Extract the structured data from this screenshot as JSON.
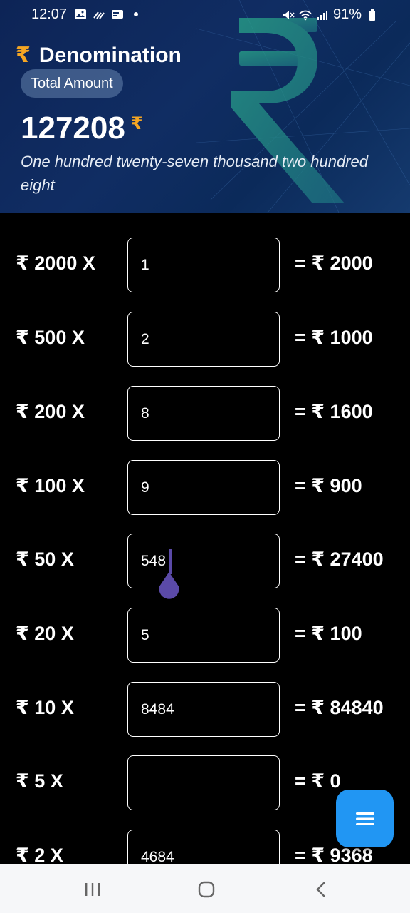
{
  "status_bar": {
    "time": "12:07",
    "battery": "91%"
  },
  "header": {
    "app_title": "Denomination",
    "total_label": "Total Amount",
    "total_value": "127208",
    "currency_symbol": "₹",
    "amount_in_words": "One hundred twenty-seven thousand two hundred eight"
  },
  "rows": [
    {
      "label": "₹ 2000 X",
      "value": "1",
      "result": "= ₹ 2000"
    },
    {
      "label": "₹ 500 X",
      "value": "2",
      "result": "= ₹ 1000"
    },
    {
      "label": "₹ 200 X",
      "value": "8",
      "result": "= ₹ 1600"
    },
    {
      "label": "₹ 100 X",
      "value": "9",
      "result": "= ₹ 900"
    },
    {
      "label": "₹ 50 X",
      "value": "548",
      "result": "= ₹ 27400"
    },
    {
      "label": "₹ 20 X",
      "value": "5",
      "result": "= ₹ 100"
    },
    {
      "label": "₹ 10 X",
      "value": "8484",
      "result": "= ₹ 84840"
    },
    {
      "label": "₹ 5 X",
      "value": "",
      "result": "= ₹ 0"
    },
    {
      "label": "₹ 2 X",
      "value": "4684",
      "result": "= ₹ 9368"
    }
  ],
  "fab": {
    "icon": "menu-icon"
  },
  "colors": {
    "accent_orange": "#f5a623",
    "fab_blue": "#2196f3",
    "cursor_purple": "#5b4aa8",
    "header_blue": "#102d63"
  }
}
